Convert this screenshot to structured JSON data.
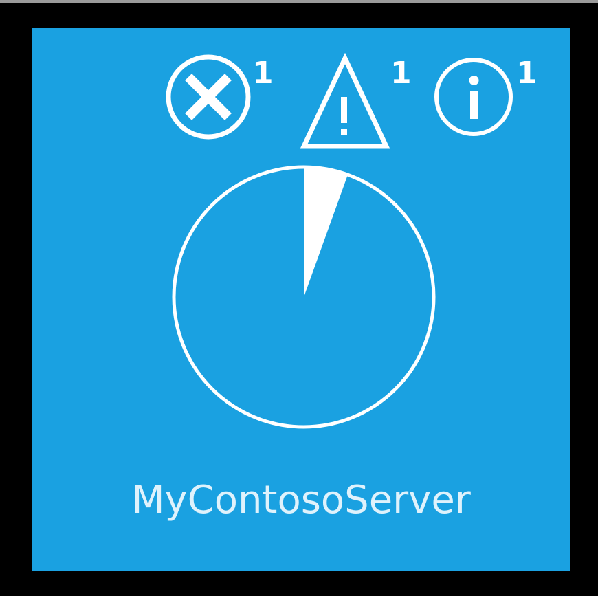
{
  "tile": {
    "background_color": "#1aa1e1",
    "server_name": "MyContosoServer"
  },
  "alerts": {
    "error": {
      "icon": "error-circle-x-icon",
      "count": "1"
    },
    "warning": {
      "icon": "warning-triangle-icon",
      "count": "1"
    },
    "info": {
      "icon": "info-circle-icon",
      "count": "1"
    }
  },
  "usage_gauge": {
    "icon": "pie-gauge-icon",
    "fill_fraction": 0.055,
    "fill_color": "#ffffff"
  }
}
